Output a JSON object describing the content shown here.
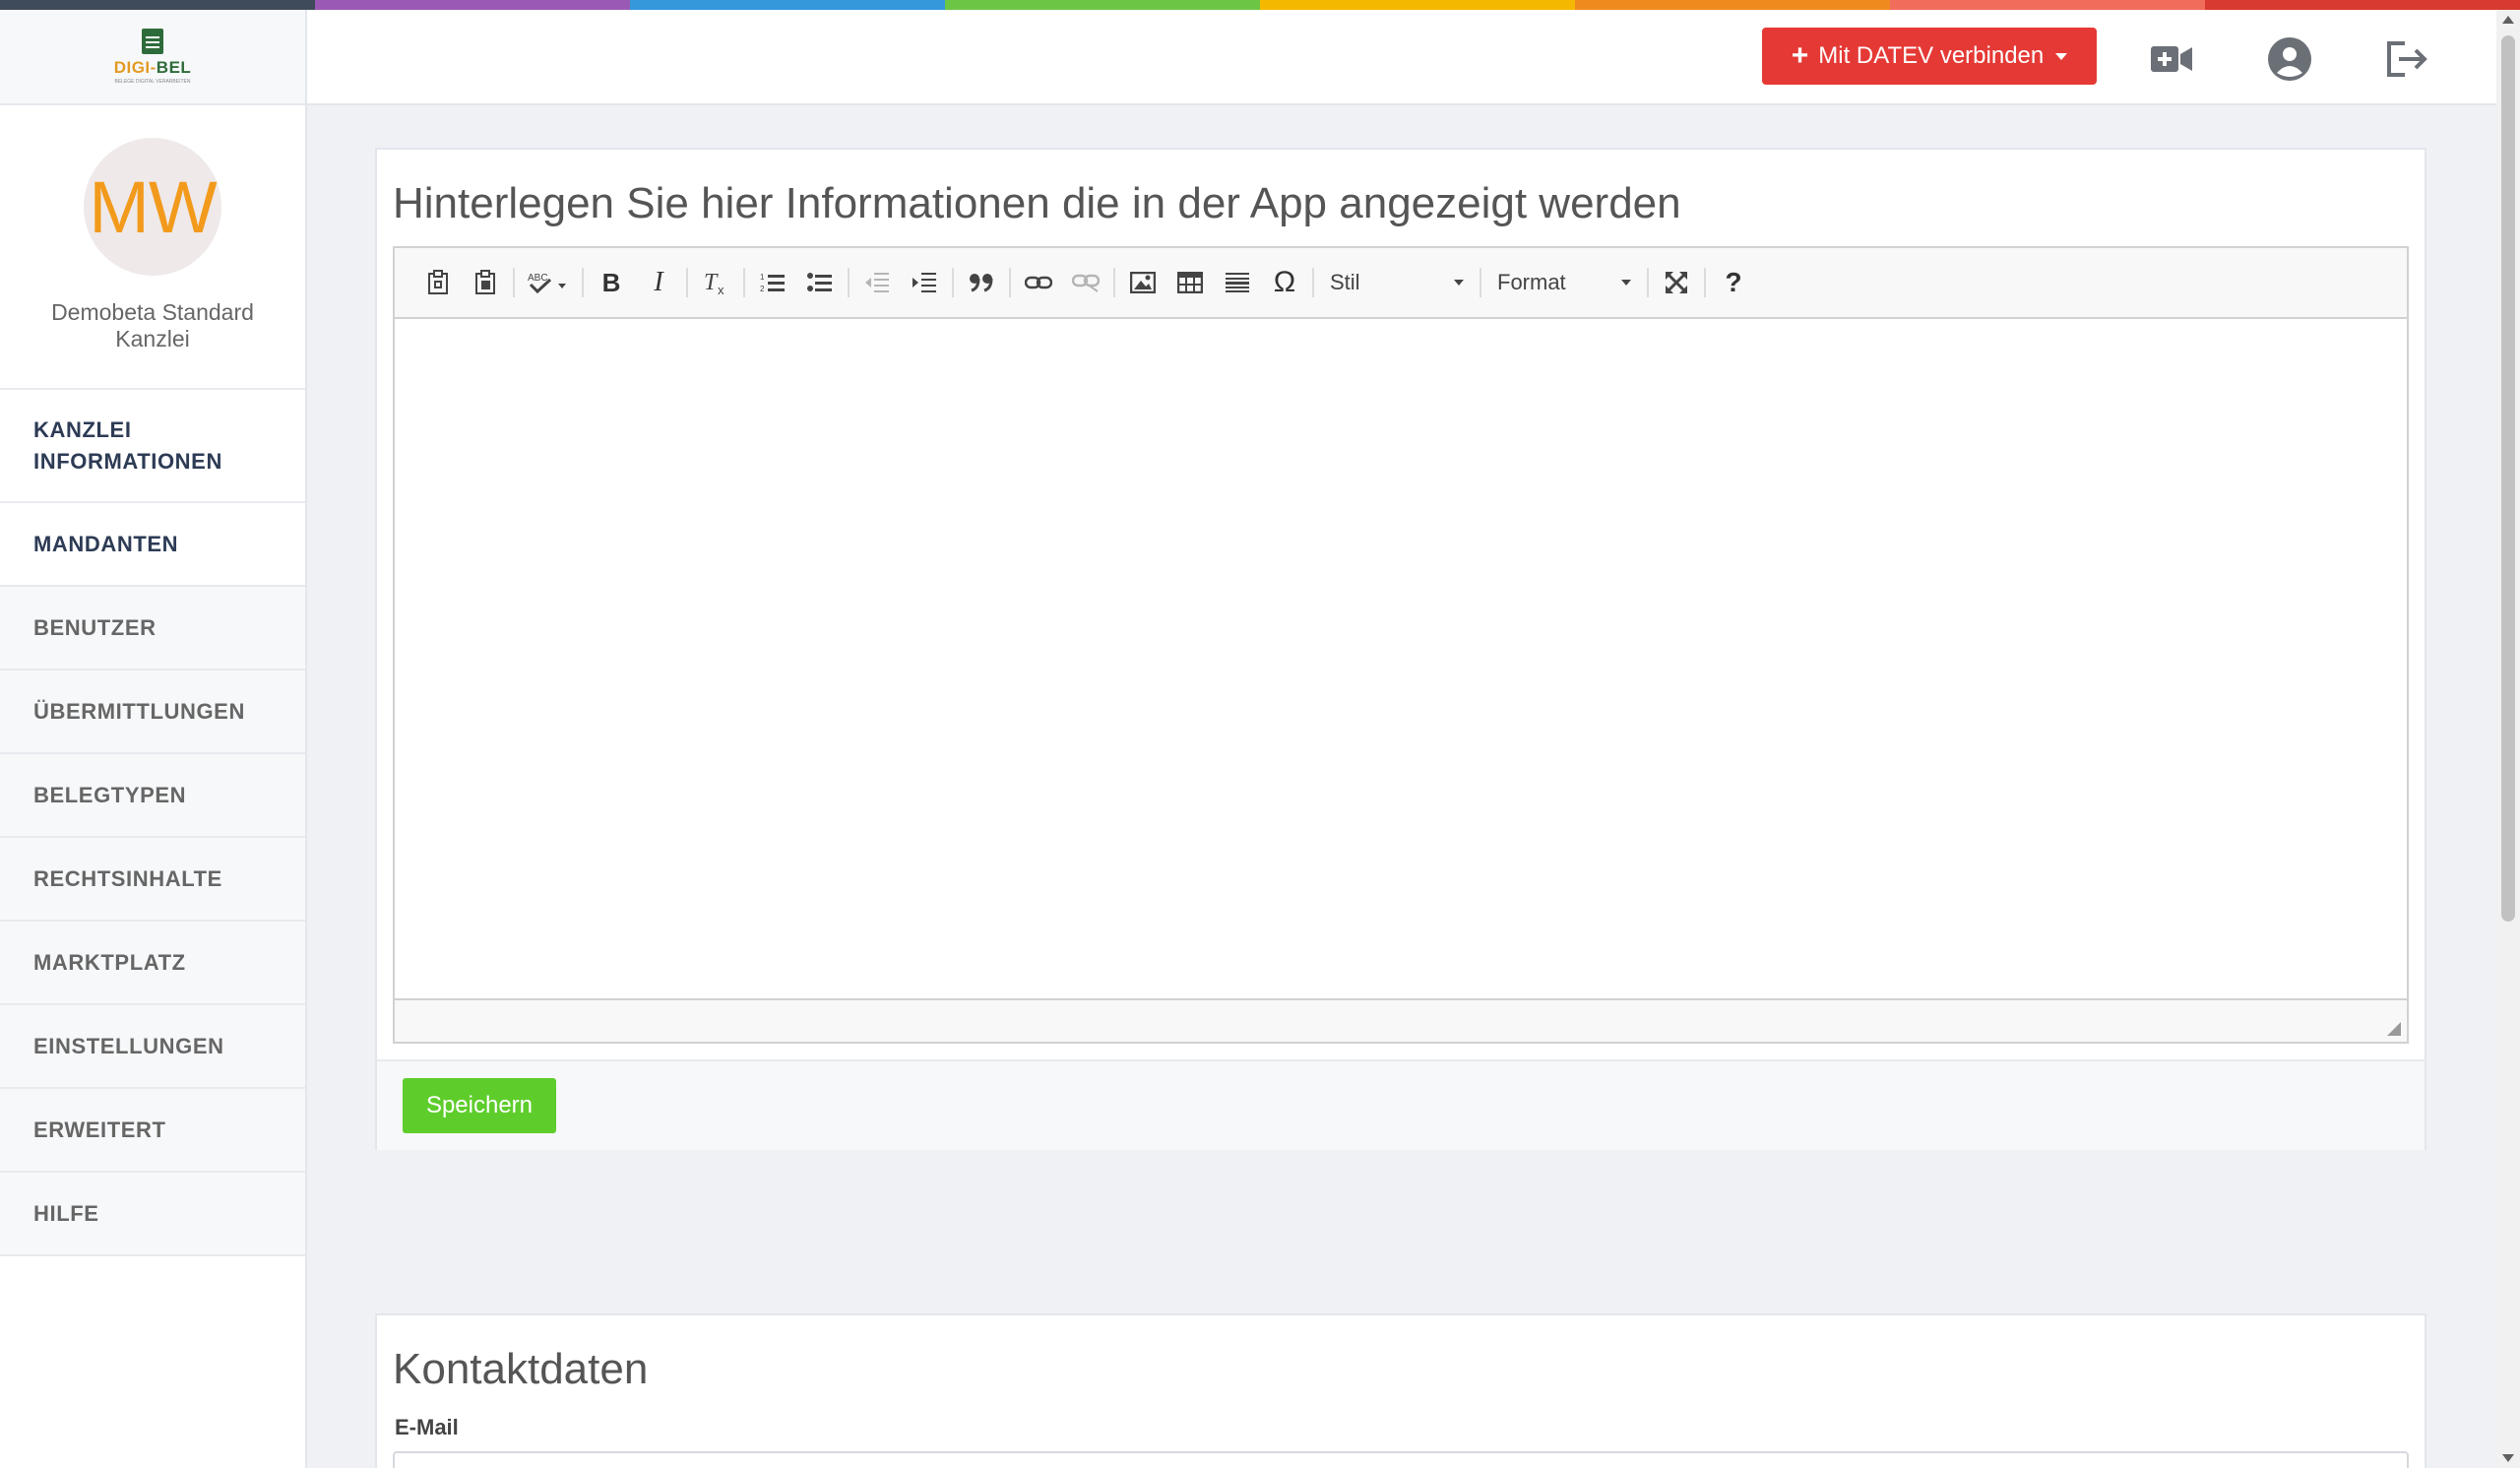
{
  "rainbow_colors": [
    "#3f4b5b",
    "#9b59b6",
    "#3498db",
    "#6cc644",
    "#f5b800",
    "#ef8a1f",
    "#f06d5c",
    "#d93a2f"
  ],
  "logo": {
    "word_a": "DIGI-",
    "word_b": "BEL",
    "sub": "BELEGE DIGITAL VERARBEITEN"
  },
  "profile": {
    "initials": "MW",
    "name": "Demobeta Standard Kanzlei"
  },
  "sidebar": {
    "items": [
      {
        "label": "KANZLEI INFORMATIONEN"
      },
      {
        "label": "MANDANTEN"
      },
      {
        "label": "BENUTZER"
      },
      {
        "label": "ÜBERMITTLUNGEN"
      },
      {
        "label": "BELEGTYPEN"
      },
      {
        "label": "RECHTSINHALTE"
      },
      {
        "label": "MARKTPLATZ"
      },
      {
        "label": "EINSTELLUNGEN"
      },
      {
        "label": "ERWEITERT"
      },
      {
        "label": "HILFE"
      }
    ]
  },
  "topbar": {
    "datev_button": "Mit DATEV verbinden",
    "icons": [
      "video-plus-icon",
      "user-circle-icon",
      "logout-icon"
    ]
  },
  "info_panel": {
    "title": "Hinterlegen Sie hier Informationen die in der App angezeigt werden",
    "toolbar": {
      "style_combo": "Stil",
      "format_combo": "Format"
    },
    "save_button": "Speichern"
  },
  "contact_panel": {
    "title": "Kontaktdaten",
    "email_label": "E-Mail",
    "email_value": ""
  }
}
